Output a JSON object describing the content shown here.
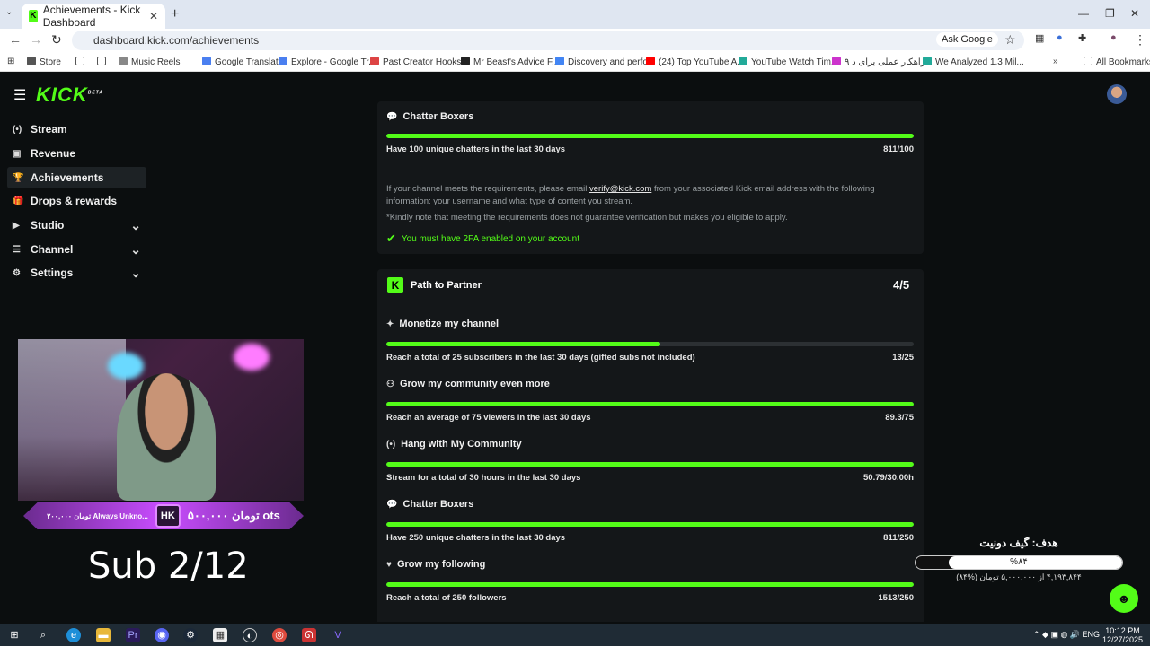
{
  "browser": {
    "tab_title": "Achievements - Kick Dashboard",
    "url": "dashboard.kick.com/achievements",
    "ask_google": "Ask Google",
    "bookmarks": [
      {
        "label": "Store",
        "color": "#555"
      },
      {
        "label": "",
        "color": "#888"
      },
      {
        "label": "",
        "color": "#888"
      },
      {
        "label": "Music Reels",
        "color": "#888"
      },
      {
        "label": "Google Translate",
        "color": "#4a7ff0"
      },
      {
        "label": "Explore - Google Tr...",
        "color": "#4a7ff0"
      },
      {
        "label": "Past Creator Hooks...",
        "color": "#d44"
      },
      {
        "label": "Mr Beast's Advice F...",
        "color": "#222"
      },
      {
        "label": "Discovery and perfo...",
        "color": "#4285f4"
      },
      {
        "label": "(24) Top YouTube A...",
        "color": "#f00"
      },
      {
        "label": "YouTube Watch Tim...",
        "color": "#2a9"
      },
      {
        "label": "۹ راهکار عملی برای د...",
        "color": "#c3c"
      },
      {
        "label": "We Analyzed 1.3 Mil...",
        "color": "#2a9"
      }
    ],
    "all_bookmarks": "All Bookmarks"
  },
  "app": {
    "logo": "KICK",
    "logo_badge": "BETA",
    "nav": [
      {
        "label": "Stream",
        "icon": "stream-icon",
        "glyph": "(•)",
        "active": false,
        "chevron": false
      },
      {
        "label": "Revenue",
        "icon": "revenue-icon",
        "glyph": "▣",
        "active": false,
        "chevron": false
      },
      {
        "label": "Achievements",
        "icon": "trophy-icon",
        "glyph": "🏆",
        "active": true,
        "chevron": false
      },
      {
        "label": "Drops & rewards",
        "icon": "gift-icon",
        "glyph": "🎁",
        "active": false,
        "chevron": false
      },
      {
        "label": "Studio",
        "icon": "studio-icon",
        "glyph": "▶",
        "active": false,
        "chevron": true
      },
      {
        "label": "Channel",
        "icon": "channel-icon",
        "glyph": "☰",
        "active": false,
        "chevron": true
      },
      {
        "label": "Settings",
        "icon": "gear-icon",
        "glyph": "⚙",
        "active": false,
        "chevron": true
      }
    ]
  },
  "verification": {
    "chatter": {
      "title": "Chatter Boxers",
      "desc": "Have 100 unique chatters in the last 30 days",
      "value": "811/100",
      "progress": 1.0
    },
    "note_prefix": "If your channel meets the requirements, please email ",
    "email": "verify@kick.com",
    "note_suffix": " from your associated Kick email address with the following information: your username and what type of content you stream.",
    "disclaimer": "*Kindly note that meeting the requirements does not guarantee verification but makes you eligible to apply.",
    "twofa": "You must have 2FA enabled on your account"
  },
  "partner": {
    "title": "Path to Partner",
    "count": "4/5",
    "items": [
      {
        "title": "Monetize my channel",
        "icon": "sparkle-icon",
        "glyph": "✦",
        "desc": "Reach a total of 25 subscribers in the last 30 days (gifted subs not included)",
        "value": "13/25",
        "progress": 0.52
      },
      {
        "title": "Grow my community even more",
        "icon": "community-icon",
        "glyph": "⚇",
        "desc": "Reach an average of 75 viewers in the last 30 days",
        "value": "89.3/75",
        "progress": 1.0
      },
      {
        "title": "Hang with My Community",
        "icon": "broadcast-icon",
        "glyph": "(•)",
        "desc": "Stream for a total of 30 hours in the last 30 days",
        "value": "50.79/30.00h",
        "progress": 1.0
      },
      {
        "title": "Chatter Boxers",
        "icon": "chat-icon",
        "glyph": "💬",
        "desc": "Have 250 unique chatters in the last 30 days",
        "value": "811/250",
        "progress": 1.0
      },
      {
        "title": "Grow my following",
        "icon": "heart-icon",
        "glyph": "♥",
        "desc": "Reach a total of 250 followers",
        "value": "1513/250",
        "progress": 1.0
      }
    ]
  },
  "overlay": {
    "banner_small": "۲۰۰,۰۰۰ تومان Always Unkno...",
    "banner_hk": "HK",
    "banner_main": "۵۰۰,۰۰۰ تومان ots",
    "sub_text": "Sub 2/12",
    "donate_title": "هدف: گیف دونیت",
    "donate_percent": "%۸۴",
    "donate_progress": 0.84,
    "donate_sub": "۴,۱۹۳,۸۴۴ از ۵,۰۰۰,۰۰۰ تومان (%۸۴)"
  },
  "taskbar": {
    "lang": "ENG",
    "time": "10:12 PM",
    "date": "12/27/2025"
  },
  "colors": {
    "accent": "#53fc18",
    "background": "#0b0e0f",
    "card": "#141719"
  }
}
